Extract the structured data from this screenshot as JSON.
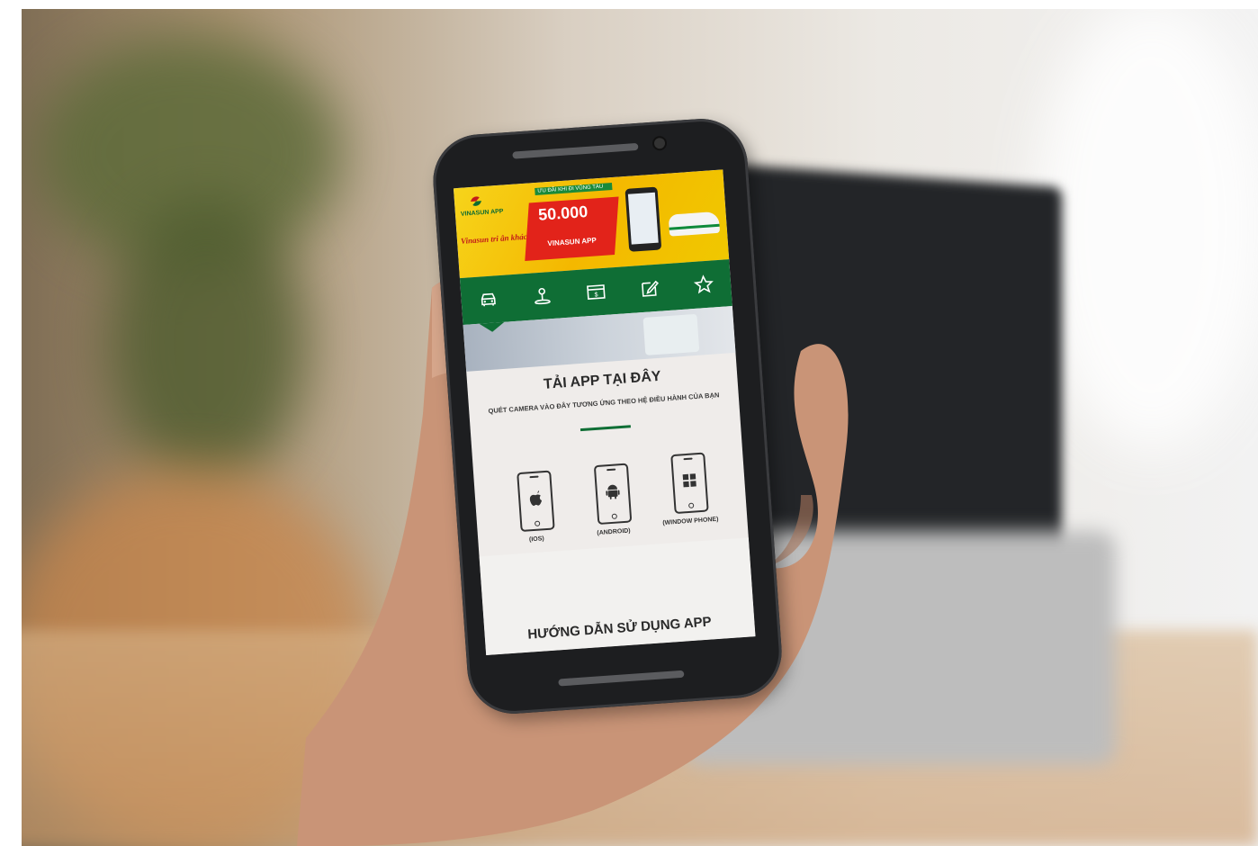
{
  "banner": {
    "logo_text": "VINASUN APP",
    "slogan": "Vinasun tri ân khách hàng",
    "promo_top": "ƯU ĐÃI KHI ĐI VŨNG TÀU",
    "promo_amount": "50.000",
    "promo_brand": "VINASUN APP"
  },
  "nav": {
    "items": [
      {
        "name": "taxi-icon"
      },
      {
        "name": "location-icon"
      },
      {
        "name": "price-icon"
      },
      {
        "name": "edit-icon"
      },
      {
        "name": "star-icon"
      }
    ]
  },
  "download": {
    "title": "TẢI APP TẠI ĐÂY",
    "subtitle": "QUÉT CAMERA VÀO ĐÂY TƯƠNG ỨNG THEO HỆ ĐIỀU HÀNH CỦA BẠN",
    "platforms": [
      {
        "label": "(IOS)",
        "icon": "apple-icon"
      },
      {
        "label": "(ANDROID)",
        "icon": "android-icon"
      },
      {
        "label": "(WINDOW PHONE)",
        "icon": "windows-icon"
      }
    ]
  },
  "guide": {
    "title": "HƯỚNG DẪN SỬ DỤNG APP"
  },
  "colors": {
    "brand_green": "#0f6e35",
    "banner_yellow": "#f6d41b",
    "promo_red": "#e2231a"
  }
}
